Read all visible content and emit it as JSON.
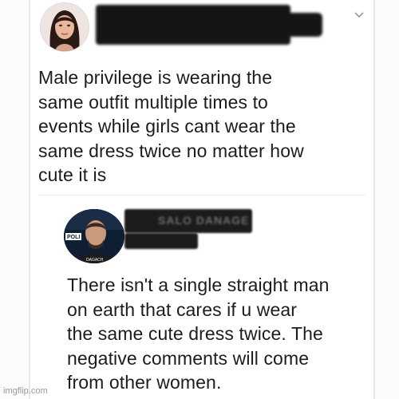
{
  "post": {
    "text": "Male privilege is wearing the\nsame outfit multiple times to\nevents while girls cant wear the\nsame dress twice  no matter how\ncute it is"
  },
  "reply": {
    "name_partial": "SALO DANAGE",
    "avatar_badge": "POLI",
    "avatar_caption": "DAGACH",
    "text": "There isn't a single straight man\non earth that cares if u wear\nthe same cute dress twice. The\nnegative comments will come\nfrom other women."
  },
  "watermark": "imgflip.com",
  "icons": {
    "post_menu": "chevron-down-icon"
  },
  "colors": {
    "text": "#1c1c1c",
    "redaction": "#151515",
    "background": "#ffffff"
  }
}
